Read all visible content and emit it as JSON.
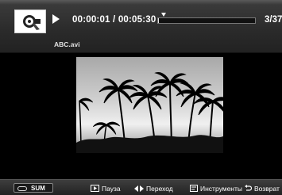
{
  "player": {
    "time_display": "00:00:01 / 00:05:30",
    "progress_fraction": 0.01,
    "file_counter": "3/37",
    "filename": "ABC.avi"
  },
  "bottom_bar": {
    "sum_label": "SUM",
    "pause_label": "Пауза",
    "seek_label": "Переход",
    "tools_label": "Инструменты",
    "return_label": "Возврат"
  },
  "icons": [
    "video-file-icon",
    "play-icon",
    "pause-key-icon",
    "left-right-arrows-icon",
    "tools-icon",
    "return-icon",
    "sum-icon"
  ]
}
